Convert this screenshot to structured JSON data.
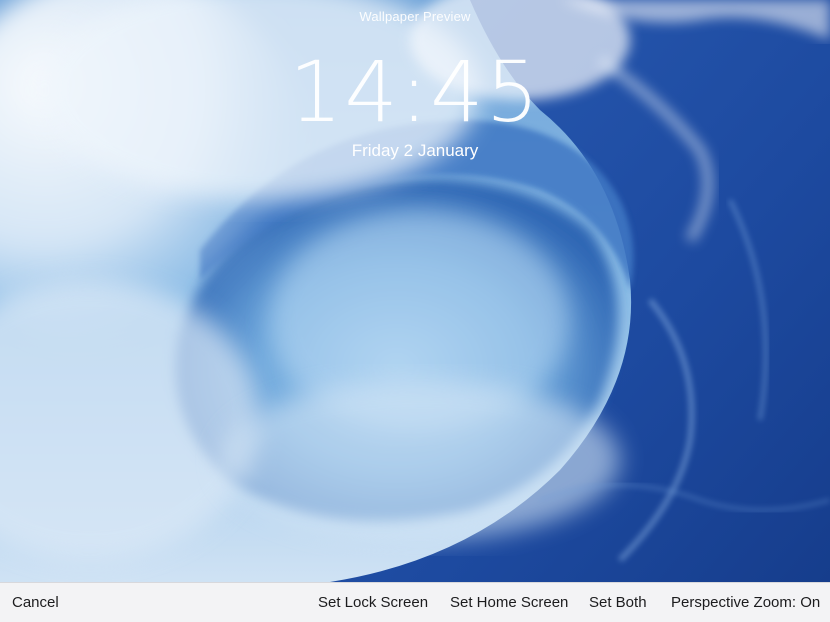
{
  "preview": {
    "title": "Wallpaper Preview",
    "time": "14:45",
    "date": "Friday 2 January"
  },
  "wallpaper": {
    "subject": "ocean wave barrel",
    "colors": {
      "sky": "#7fb0e0",
      "deep_water": "#1f4fa8",
      "wave_face": "#5f9bd6",
      "foam": "#eef4fb"
    }
  },
  "toolbar": {
    "cancel_label": "Cancel",
    "set_lock_label": "Set Lock Screen",
    "set_home_label": "Set Home Screen",
    "set_both_label": "Set Both",
    "perspective_zoom_label": "Perspective Zoom: On"
  }
}
